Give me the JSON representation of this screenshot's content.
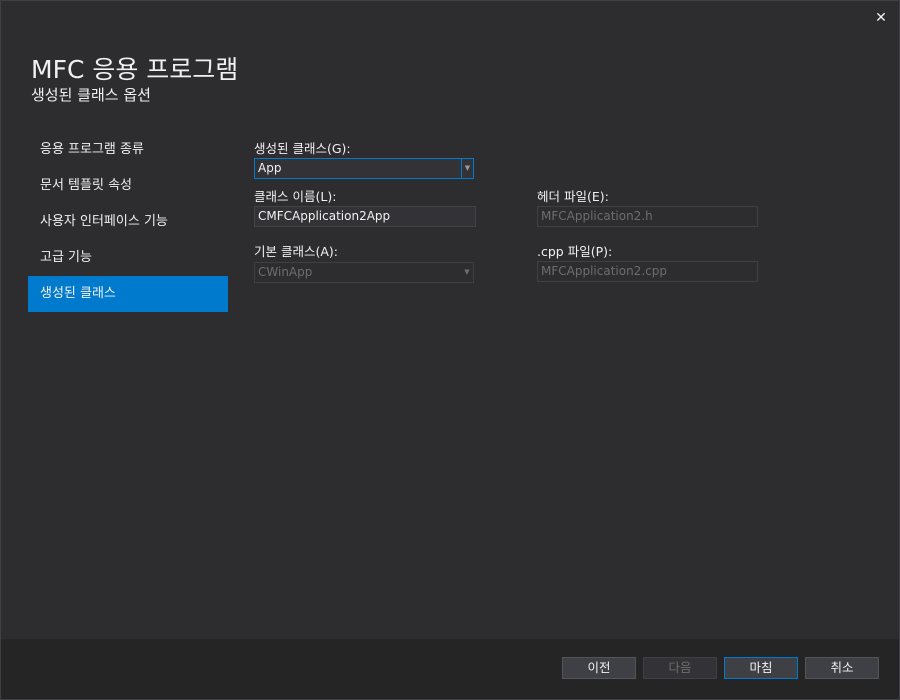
{
  "window": {
    "close_glyph": "✕"
  },
  "header": {
    "title": "MFC 응용 프로그램",
    "subtitle": "생성된 클래스 옵션"
  },
  "nav": {
    "items": [
      {
        "label": "응용 프로그램 종류",
        "selected": false
      },
      {
        "label": "문서 템플릿 속성",
        "selected": false
      },
      {
        "label": "사용자 인터페이스 기능",
        "selected": false
      },
      {
        "label": "고급 기능",
        "selected": false
      },
      {
        "label": "생성된 클래스",
        "selected": true
      }
    ]
  },
  "form": {
    "generated_classes_label": "생성된 클래스(G):",
    "generated_classes_value": "App",
    "class_name_label": "클래스 이름(L):",
    "class_name_value": "CMFCApplication2App",
    "header_file_label": "헤더 파일(E):",
    "header_file_value": "MFCApplication2.h",
    "base_class_label": "기본 클래스(A):",
    "base_class_value": "CWinApp",
    "cpp_file_label": ".cpp 파일(P):",
    "cpp_file_value": "MFCApplication2.cpp"
  },
  "footer": {
    "prev_label": "이전",
    "next_label": "다음",
    "finish_label": "마침",
    "cancel_label": "취소"
  },
  "colors": {
    "background": "#2d2d30",
    "accent": "#007acc",
    "footer": "#252526",
    "disabled_text": "#6d6d6d"
  }
}
